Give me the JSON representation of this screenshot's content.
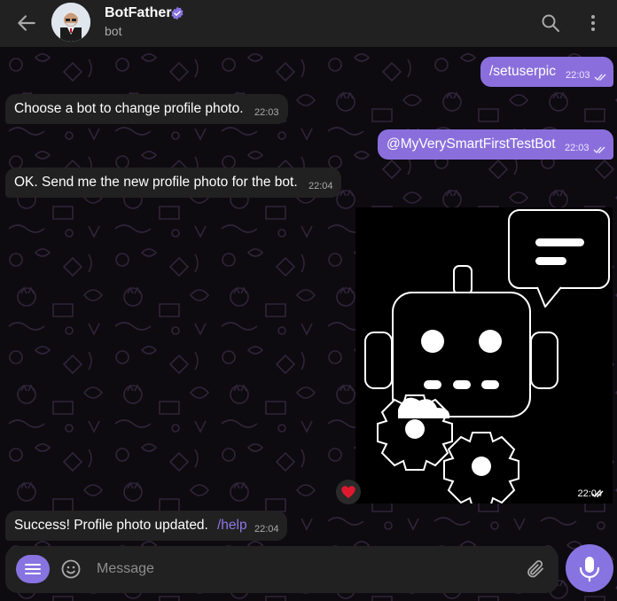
{
  "header": {
    "name": "BotFather",
    "status": "bot",
    "verified": true
  },
  "messages": [
    {
      "direction": "out",
      "text": "/setuserpic",
      "time": "22:03",
      "read": true
    },
    {
      "direction": "in",
      "text": "Choose a bot to change profile photo.",
      "time": "22:03"
    },
    {
      "direction": "out",
      "text": "@MyVerySmartFirstTestBot",
      "time": "22:03",
      "read": true
    },
    {
      "direction": "in",
      "text": "OK. Send me the new profile photo for the bot.",
      "time": "22:04"
    },
    {
      "direction": "out",
      "type": "photo",
      "image": "robot-with-gears-and-speech-bubble",
      "time": "22:04",
      "read": true,
      "reaction": "❤️"
    },
    {
      "direction": "in",
      "text": "Success! Profile photo updated.",
      "link": "/help",
      "time": "22:04"
    }
  ],
  "composer": {
    "placeholder": "Message"
  },
  "icons": {
    "back": "arrow-left-icon",
    "search": "search-icon",
    "more": "more-vertical-icon",
    "menu": "bot-menu-icon",
    "emoji": "smile-icon",
    "attach": "paperclip-icon",
    "mic": "microphone-icon",
    "verified": "verified-badge-icon"
  },
  "colors": {
    "accent": "#8774e1",
    "outgoing_bubble": "#8a6fdc",
    "incoming_bubble": "#212121",
    "header_bg": "#212121",
    "chat_bg": "#0d0a10",
    "link": "#8e78e6"
  }
}
